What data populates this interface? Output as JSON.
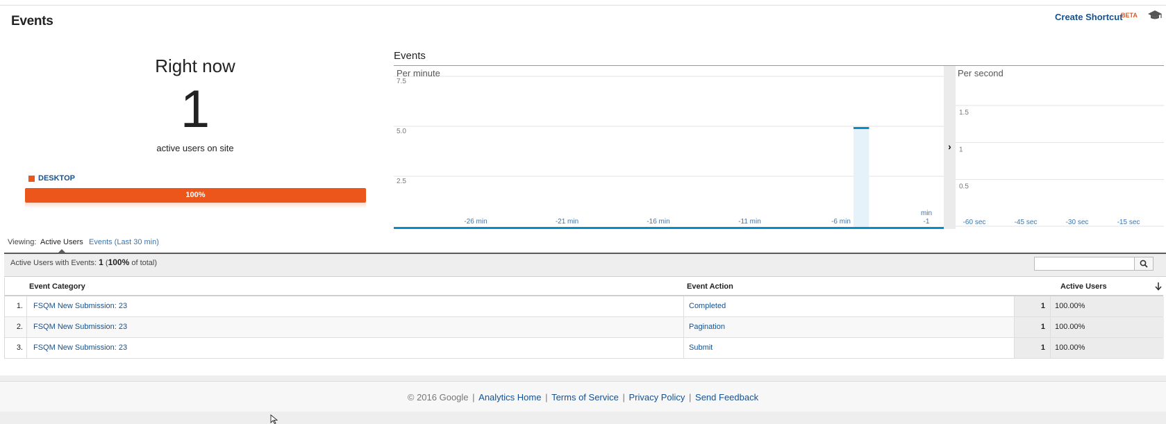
{
  "header": {
    "title": "Events",
    "create_shortcut": "Create Shortcut",
    "beta": "BETA",
    "help_icon": "graduation-cap-icon"
  },
  "right_now": {
    "title": "Right now",
    "count": "1",
    "subtitle": "active users on site",
    "device_label": "DESKTOP",
    "device_percent_label": "100%",
    "device_percent": 100,
    "device_color": "#ed561b"
  },
  "chart_data": {
    "type": "bar",
    "title": "Events",
    "per_minute": {
      "label": "Per minute",
      "y_ticks": [
        "2.5",
        "5.0",
        "7.5"
      ],
      "ylim": [
        0,
        7.5
      ],
      "x_ticks": [
        "-26 min",
        "-21 min",
        "-16 min",
        "-11 min",
        "-6 min",
        "-1"
      ],
      "x_unit_label": "min",
      "categories": [
        "-30",
        "-29",
        "-28",
        "-27",
        "-26",
        "-25",
        "-24",
        "-23",
        "-22",
        "-21",
        "-20",
        "-19",
        "-18",
        "-17",
        "-16",
        "-15",
        "-14",
        "-13",
        "-12",
        "-11",
        "-10",
        "-9",
        "-8",
        "-7",
        "-6",
        "-5",
        "-4",
        "-3",
        "-2",
        "-1"
      ],
      "values": [
        0,
        0,
        0,
        0,
        0,
        0,
        0,
        0,
        0,
        0,
        0,
        0,
        0,
        0,
        0,
        0,
        0,
        0,
        0,
        0,
        0,
        0,
        0,
        0,
        0,
        5,
        0,
        0,
        0,
        0
      ],
      "bar_color": "#058dc7"
    },
    "per_second": {
      "label": "Per second",
      "y_ticks": [
        "0.5",
        "1",
        "1.5"
      ],
      "ylim": [
        0,
        1.5
      ],
      "x_ticks": [
        "-60 sec",
        "-45 sec",
        "-30 sec",
        "-15 sec"
      ],
      "values": []
    }
  },
  "viewing": {
    "label": "Viewing:",
    "tabs": [
      "Active Users",
      "Events (Last 30 min)"
    ]
  },
  "summary": {
    "prefix": "Active Users with Events:",
    "count": "1",
    "open_paren": " (",
    "percent": "100%",
    "suffix": " of total)",
    "search_placeholder": "",
    "search_icon": "search-icon"
  },
  "table": {
    "headers": {
      "category": "Event Category",
      "action": "Event Action",
      "users": "Active Users"
    },
    "rows": [
      {
        "num": "1.",
        "category": "FSQM New Submission: 23",
        "action": "Completed",
        "users": "1",
        "percent": "100.00%"
      },
      {
        "num": "2.",
        "category": "FSQM New Submission: 23",
        "action": "Pagination",
        "users": "1",
        "percent": "100.00%"
      },
      {
        "num": "3.",
        "category": "FSQM New Submission: 23",
        "action": "Submit",
        "users": "1",
        "percent": "100.00%"
      }
    ]
  },
  "footer": {
    "copyright": "© 2016 Google",
    "links": [
      "Analytics Home",
      "Terms of Service",
      "Privacy Policy",
      "Send Feedback"
    ]
  }
}
